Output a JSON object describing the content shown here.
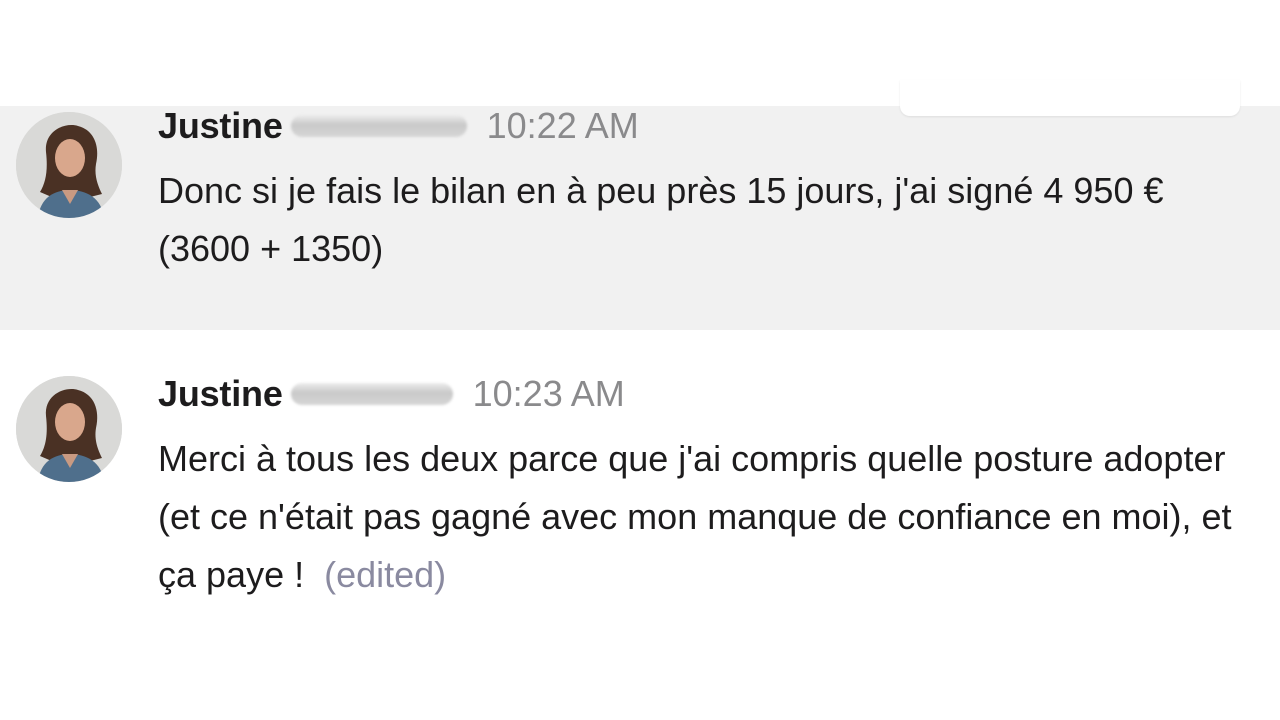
{
  "messages": [
    {
      "sender": "Justine",
      "time": "10:22 AM",
      "text": "Donc si je fais le bilan en à peu près 15 jours, j'ai signé 4 950 € (3600 + 1350)",
      "edited_label": ""
    },
    {
      "sender": "Justine",
      "time": "10:23 AM",
      "text": "Merci à tous les deux parce que j'ai compris quelle posture adopter (et ce n'était pas gagné avec mon manque de confiance en moi), et ça paye !",
      "edited_label": "(edited)"
    }
  ],
  "colors": {
    "highlight_background": "#f1f1f1",
    "sender_text": "#1d1c1d",
    "timestamp_text": "#8a8a8c",
    "edited_text": "#8a8aa0"
  }
}
